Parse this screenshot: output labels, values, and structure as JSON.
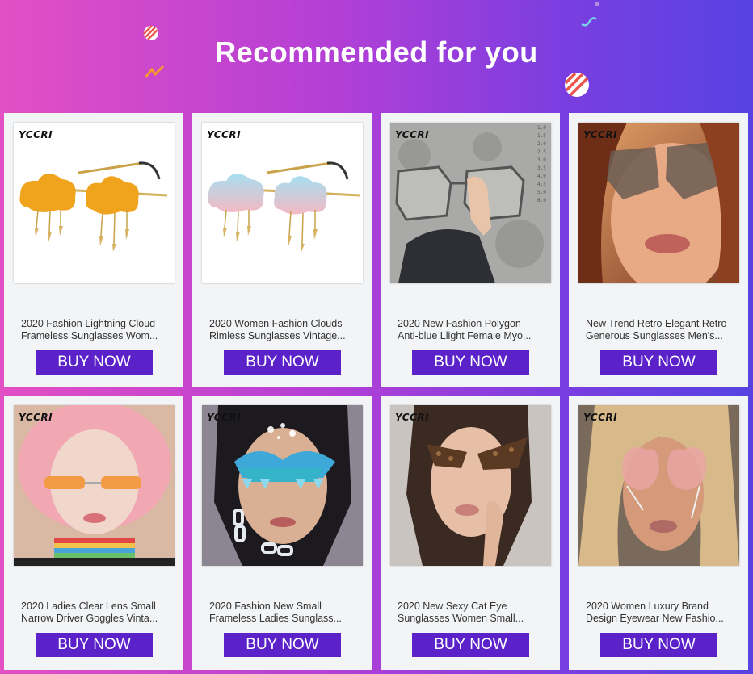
{
  "header": {
    "title": "Recommended for you"
  },
  "products": [
    {
      "brand": "YCCRI",
      "name_line1": "2020 Fashion Lightning Cloud",
      "name_line2": "Frameless Sunglasses Wom...",
      "buy_label": "BUY NOW",
      "image": "yellow-cloud-sunglasses"
    },
    {
      "brand": "YCCRI",
      "name_line1": "2020 Women Fashion Clouds",
      "name_line2": "Rimless Sunglasses Vintage...",
      "buy_label": "BUY NOW",
      "image": "blue-pink-cloud-sunglasses"
    },
    {
      "brand": "YCCRI",
      "name_line1": "2020 New Fashion Polygon",
      "name_line2": "Anti-blue Llight Female Myo...",
      "buy_label": "BUY NOW",
      "image": "clear-polygon-glasses"
    },
    {
      "brand": "YCCRI",
      "name_line1": "New Trend Retro Elegant Retro",
      "name_line2": "Generous Sunglasses Men's...",
      "buy_label": "BUY NOW",
      "image": "woman-oversized-sunglasses"
    },
    {
      "brand": "YCCRI",
      "name_line1": "2020 Ladies Clear Lens Small",
      "name_line2": "Narrow Driver Goggles Vinta...",
      "buy_label": "BUY NOW",
      "image": "pink-hair-orange-glasses"
    },
    {
      "brand": "YCCRI",
      "name_line1": "2020 Fashion New Small",
      "name_line2": "Frameless Ladies Sunglass...",
      "buy_label": "BUY NOW",
      "image": "blue-lightning-glasses-model"
    },
    {
      "brand": "YCCRI",
      "name_line1": "2020 New Sexy Cat Eye",
      "name_line2": "Sunglasses Women Small...",
      "buy_label": "BUY NOW",
      "image": "tortoise-cat-eye-model"
    },
    {
      "brand": "YCCRI",
      "name_line1": "2020 Women Luxury Brand",
      "name_line2": "Design Eyewear New Fashio...",
      "buy_label": "BUY NOW",
      "image": "heart-glasses-model"
    }
  ]
}
